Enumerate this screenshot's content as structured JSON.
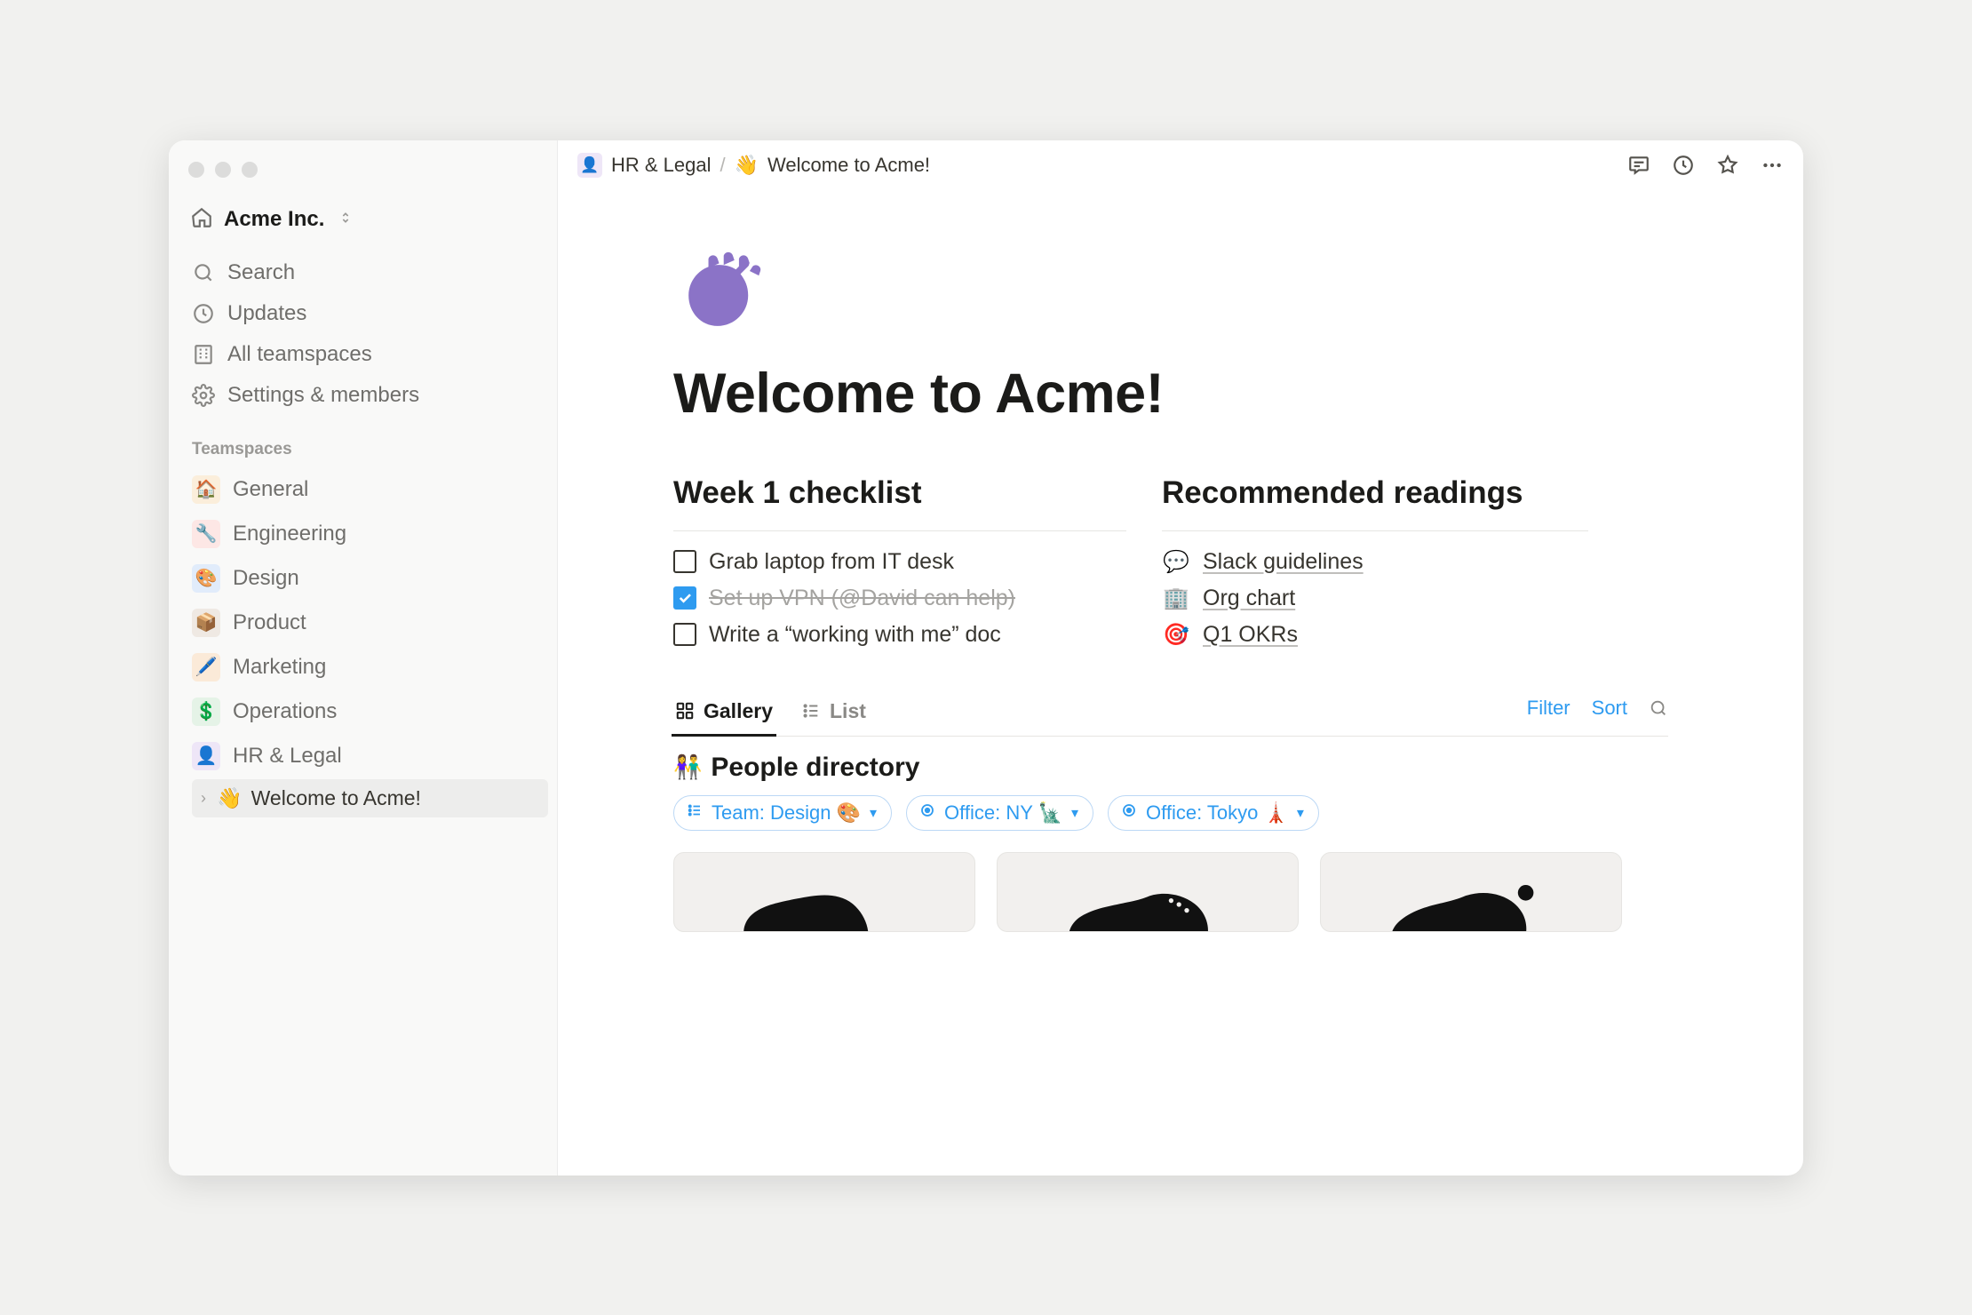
{
  "workspace": {
    "name": "Acme Inc."
  },
  "nav": {
    "search": "Search",
    "updates": "Updates",
    "all_teamspaces": "All teamspaces",
    "settings": "Settings & members"
  },
  "sidebar": {
    "section_label": "Teamspaces",
    "items": [
      {
        "label": "General",
        "emoji": "🏠",
        "bg": "#fbeedb"
      },
      {
        "label": "Engineering",
        "emoji": "🔧",
        "bg": "#fde7e5"
      },
      {
        "label": "Design",
        "emoji": "🎨",
        "bg": "#e1ecfb"
      },
      {
        "label": "Product",
        "emoji": "📦",
        "bg": "#efe9e3"
      },
      {
        "label": "Marketing",
        "emoji": "🖊️",
        "bg": "#fbead8"
      },
      {
        "label": "Operations",
        "emoji": "💲",
        "bg": "#e5f3e7"
      },
      {
        "label": "HR & Legal",
        "emoji": "👤",
        "bg": "#eee6f7"
      }
    ],
    "subpage": {
      "emoji": "👋",
      "label": "Welcome to Acme!"
    }
  },
  "breadcrumb": {
    "parent_icon": "👤",
    "parent": "HR & Legal",
    "page_icon": "👋",
    "page": "Welcome to Acme!"
  },
  "page": {
    "icon": "👋",
    "title": "Welcome to Acme!"
  },
  "checklist": {
    "heading": "Week 1 checklist",
    "items": [
      {
        "label": "Grab laptop from IT desk",
        "done": false
      },
      {
        "label": "Set up VPN (@David can help)",
        "done": true
      },
      {
        "label": "Write a “working with me” doc",
        "done": false
      }
    ]
  },
  "readings": {
    "heading": "Recommended readings",
    "items": [
      {
        "emoji": "💬",
        "label": "Slack guidelines"
      },
      {
        "emoji": "🏢",
        "label": "Org chart"
      },
      {
        "emoji": "🎯",
        "label": "Q1 OKRs"
      }
    ]
  },
  "database": {
    "views": [
      {
        "label": "Gallery",
        "icon": "gallery",
        "active": true
      },
      {
        "label": "List",
        "icon": "list",
        "active": false
      }
    ],
    "actions": {
      "filter": "Filter",
      "sort": "Sort"
    },
    "title_emoji": "👫",
    "title": "People directory",
    "chips": [
      {
        "icon": "list",
        "label": "Team: Design 🎨"
      },
      {
        "icon": "target",
        "label": "Office: NY 🗽"
      },
      {
        "icon": "target",
        "label": "Office: Tokyo 🗼"
      }
    ]
  }
}
